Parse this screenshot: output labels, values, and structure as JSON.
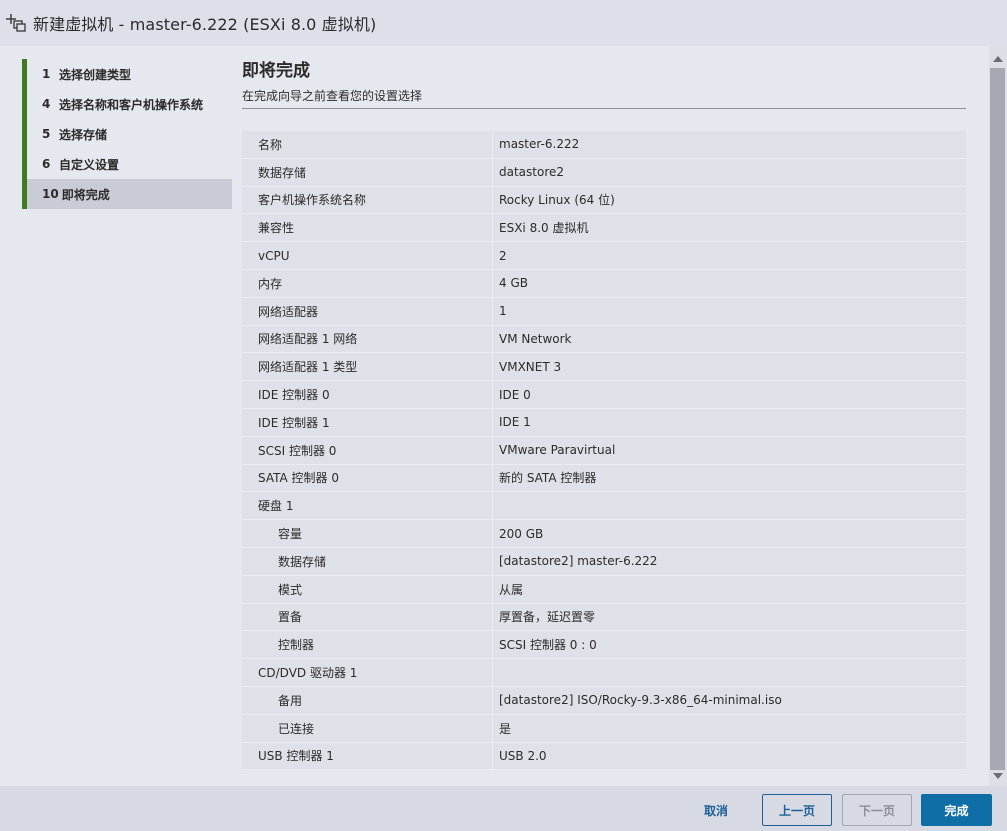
{
  "window": {
    "title": "新建虚拟机 - master-6.222 (ESXi 8.0 虚拟机)",
    "icon": "new-vm-icon"
  },
  "steps": [
    {
      "num": "1",
      "label": "选择创建类型",
      "active": false
    },
    {
      "num": "4",
      "label": "选择名称和客户机操作系统",
      "active": false
    },
    {
      "num": "5",
      "label": "选择存储",
      "active": false
    },
    {
      "num": "6",
      "label": "自定义设置",
      "active": false
    },
    {
      "num": "10",
      "label": "即将完成",
      "active": true
    }
  ],
  "page": {
    "title": "即将完成",
    "subtitle": "在完成向导之前查看您的设置选择"
  },
  "summary": [
    {
      "key": "名称",
      "value": "master-6.222"
    },
    {
      "key": "数据存储",
      "value": "datastore2"
    },
    {
      "key": "客户机操作系统名称",
      "value": "Rocky Linux (64 位)"
    },
    {
      "key": "兼容性",
      "value": "ESXi 8.0 虚拟机"
    },
    {
      "key": "vCPU",
      "value": "2"
    },
    {
      "key": "内存",
      "value": "4 GB"
    },
    {
      "key": "网络适配器",
      "value": "1"
    },
    {
      "key": "网络适配器 1 网络",
      "value": "VM Network"
    },
    {
      "key": "网络适配器 1 类型",
      "value": "VMXNET 3"
    },
    {
      "key": "IDE 控制器 0",
      "value": "IDE 0"
    },
    {
      "key": "IDE 控制器 1",
      "value": "IDE 1"
    },
    {
      "key": "SCSI 控制器 0",
      "value": "VMware Paravirtual"
    },
    {
      "key": "SATA 控制器 0",
      "value": "新的 SATA 控制器"
    },
    {
      "key": "硬盘 1",
      "value": ""
    },
    {
      "key": "容量",
      "value": "200 GB"
    },
    {
      "key": "数据存储",
      "value": "[datastore2] master-6.222"
    },
    {
      "key": "模式",
      "value": "从属"
    },
    {
      "key": "置备",
      "value": "厚置备，延迟置零"
    },
    {
      "key": "控制器",
      "value": "SCSI 控制器 0 : 0"
    },
    {
      "key": "CD/DVD 驱动器 1",
      "value": ""
    },
    {
      "key": "备用",
      "value": "[datastore2] ISO/Rocky-9.3-x86_64-minimal.iso"
    },
    {
      "key": "已连接",
      "value": "是"
    },
    {
      "key": "USB 控制器 1",
      "value": "USB 2.0"
    }
  ],
  "footer": {
    "cancel": "取消",
    "prev": "上一页",
    "next": "下一页",
    "finish": "完成"
  },
  "colors": {
    "step_accent": "#3f7a1e",
    "primary_button": "#0f6ea5",
    "link_blue": "#1d5f98"
  }
}
